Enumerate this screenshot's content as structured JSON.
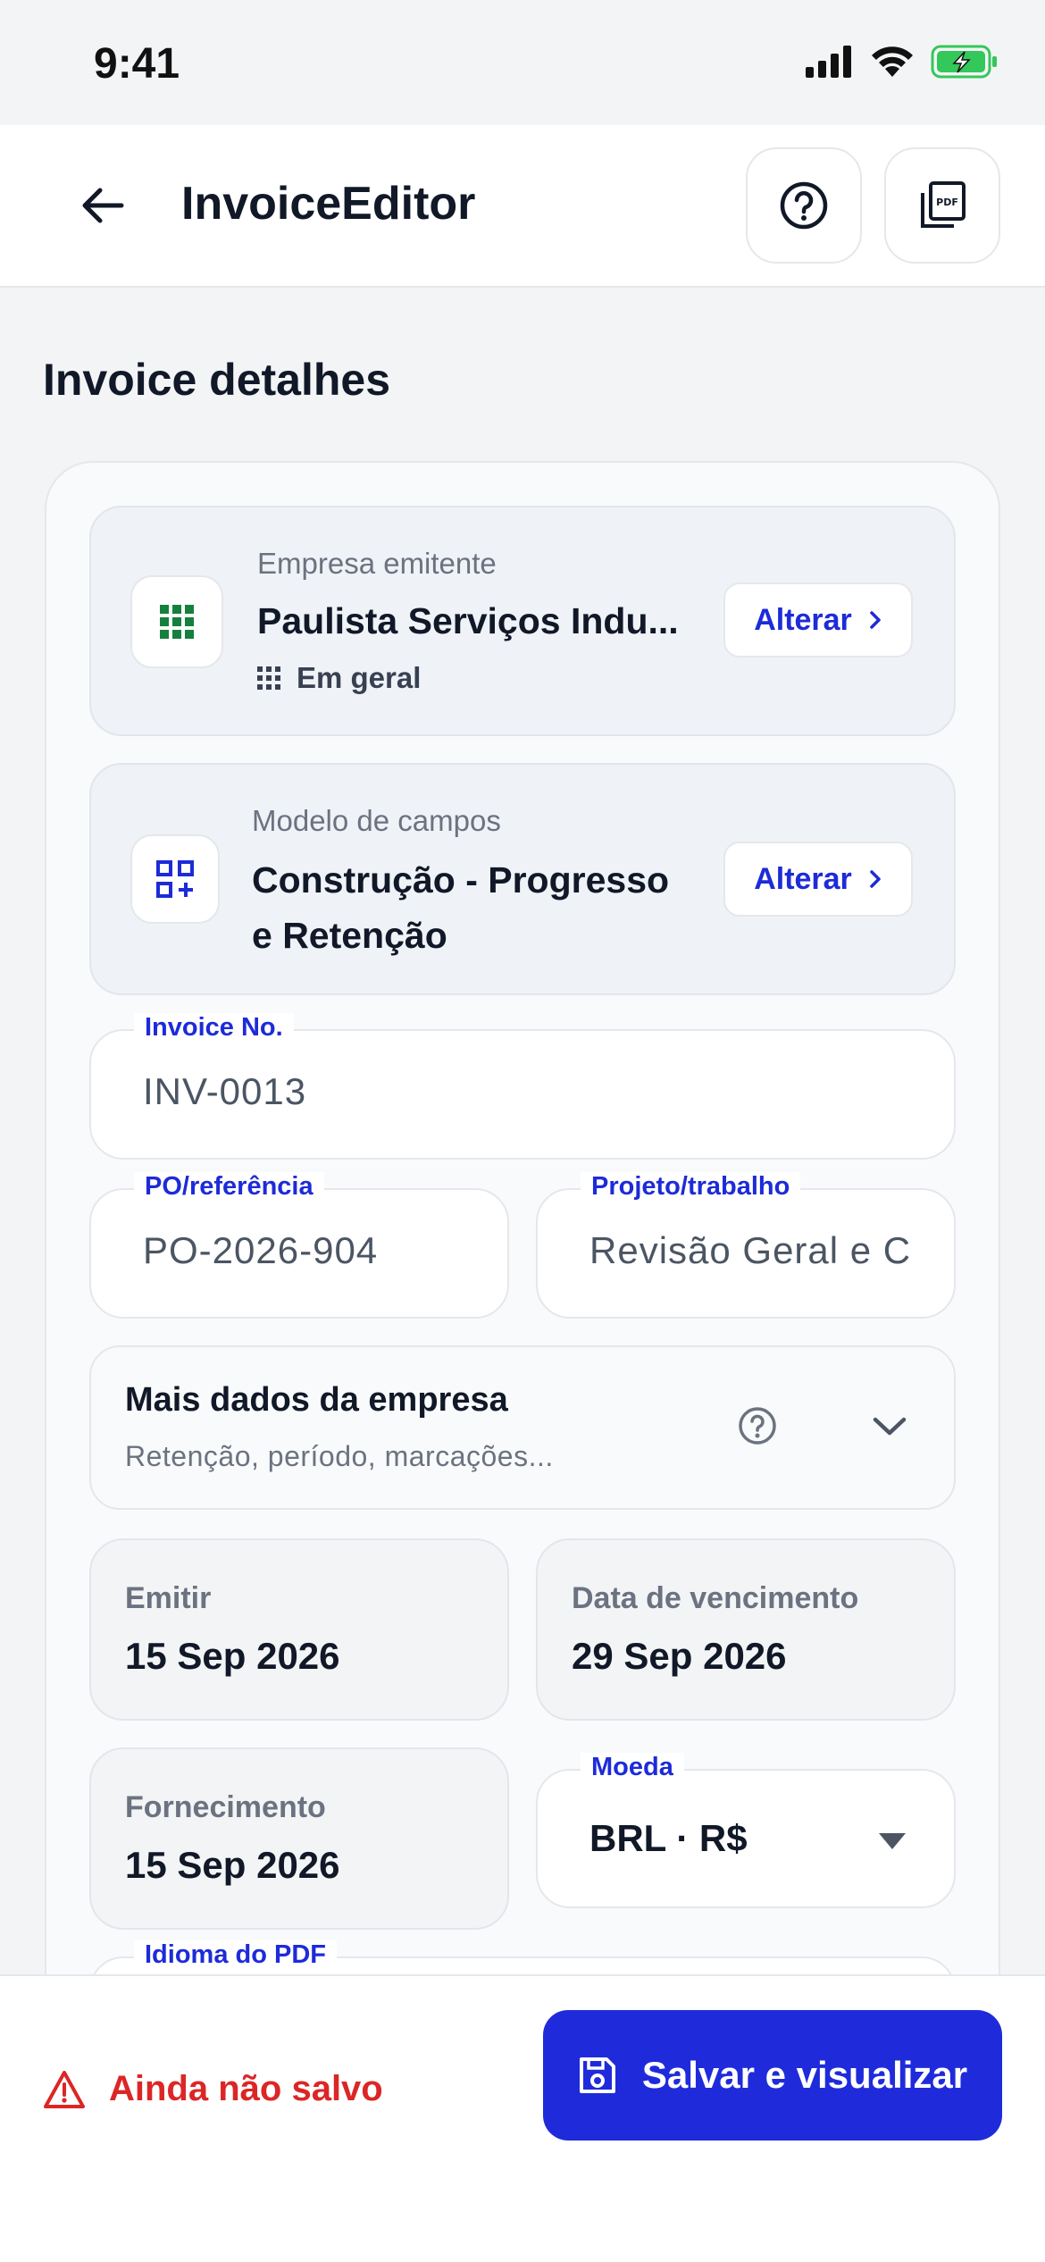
{
  "status_bar": {
    "time": "9:41"
  },
  "app_bar": {
    "title": "InvoiceEditor",
    "back_icon": "arrow-left-icon",
    "help_icon": "help-circle-icon",
    "pdf_icon": "pdf-file-icon"
  },
  "section": {
    "title": "Invoice detalhes"
  },
  "issuer": {
    "label": "Empresa emitente",
    "name": "Paulista Serviços Indu...",
    "tag": "Em geral",
    "change_label": "Alterar"
  },
  "template": {
    "label": "Modelo de campos",
    "name_line1": "Construção - Progresso",
    "name_line2": "e Retenção",
    "change_label": "Alterar"
  },
  "fields": {
    "invoice_no": {
      "label": "Invoice No.",
      "value": "INV-0013"
    },
    "po_reference": {
      "label": "PO/referência",
      "value": "PO-2026-904"
    },
    "project": {
      "label": "Projeto/trabalho",
      "value": "Revisão Geral e C"
    }
  },
  "more_company": {
    "title": "Mais dados da empresa",
    "subtitle": "Retenção, período, marcações..."
  },
  "dates": {
    "issue": {
      "label": "Emitir",
      "value": "15 Sep 2026"
    },
    "due": {
      "label": "Data de vencimento",
      "value": "29 Sep 2026"
    },
    "supply": {
      "label": "Fornecimento",
      "value": "15 Sep 2026"
    }
  },
  "currency": {
    "label": "Moeda",
    "value": "BRL · R$"
  },
  "pdf_language": {
    "label": "Idioma do PDF"
  },
  "bottom": {
    "unsaved_label": "Ainda não salvo",
    "save_label": "Salvar e visualizar"
  },
  "colors": {
    "accent": "#1f2bdb",
    "danger": "#dc2626",
    "battery": "#34c759"
  }
}
